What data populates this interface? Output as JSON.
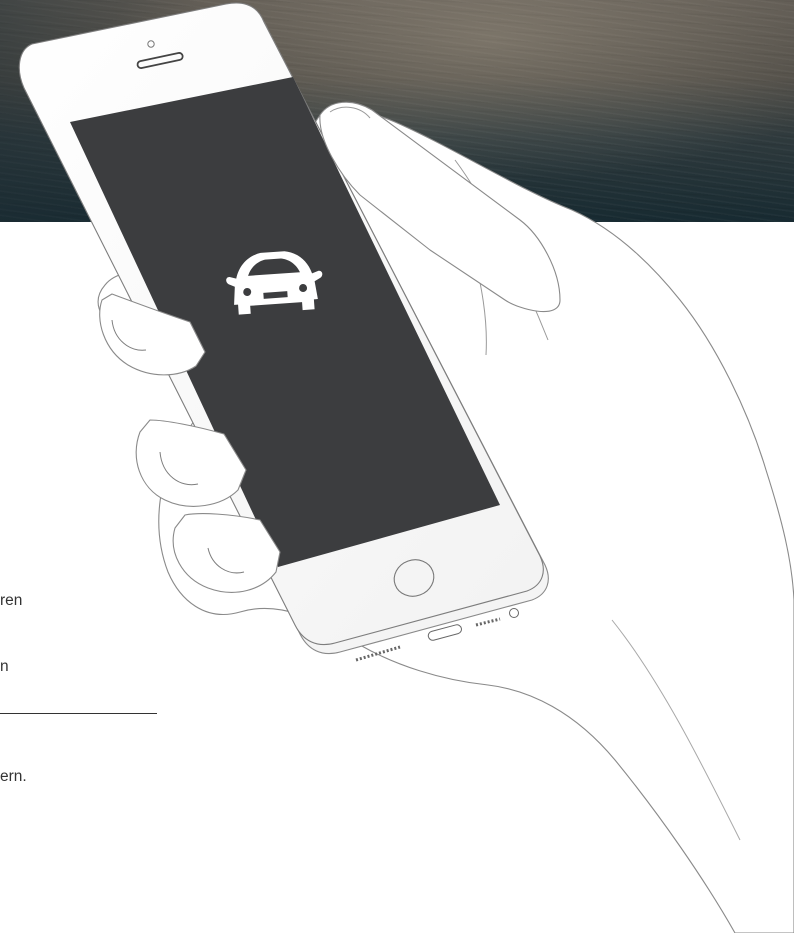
{
  "hero": {
    "photo": "motion-blurred road photograph",
    "colors": {
      "top": "#5e5952",
      "bottom": "#172a31"
    }
  },
  "text_block": {
    "lines": [
      "ren",
      "n",
      "",
      "ern."
    ]
  },
  "illustration": {
    "phone_screen_color": "#3c3d3f",
    "screen_icon": "car-front-icon",
    "outline_color": "#8a8a8a",
    "hand_fill": "#ffffff"
  }
}
